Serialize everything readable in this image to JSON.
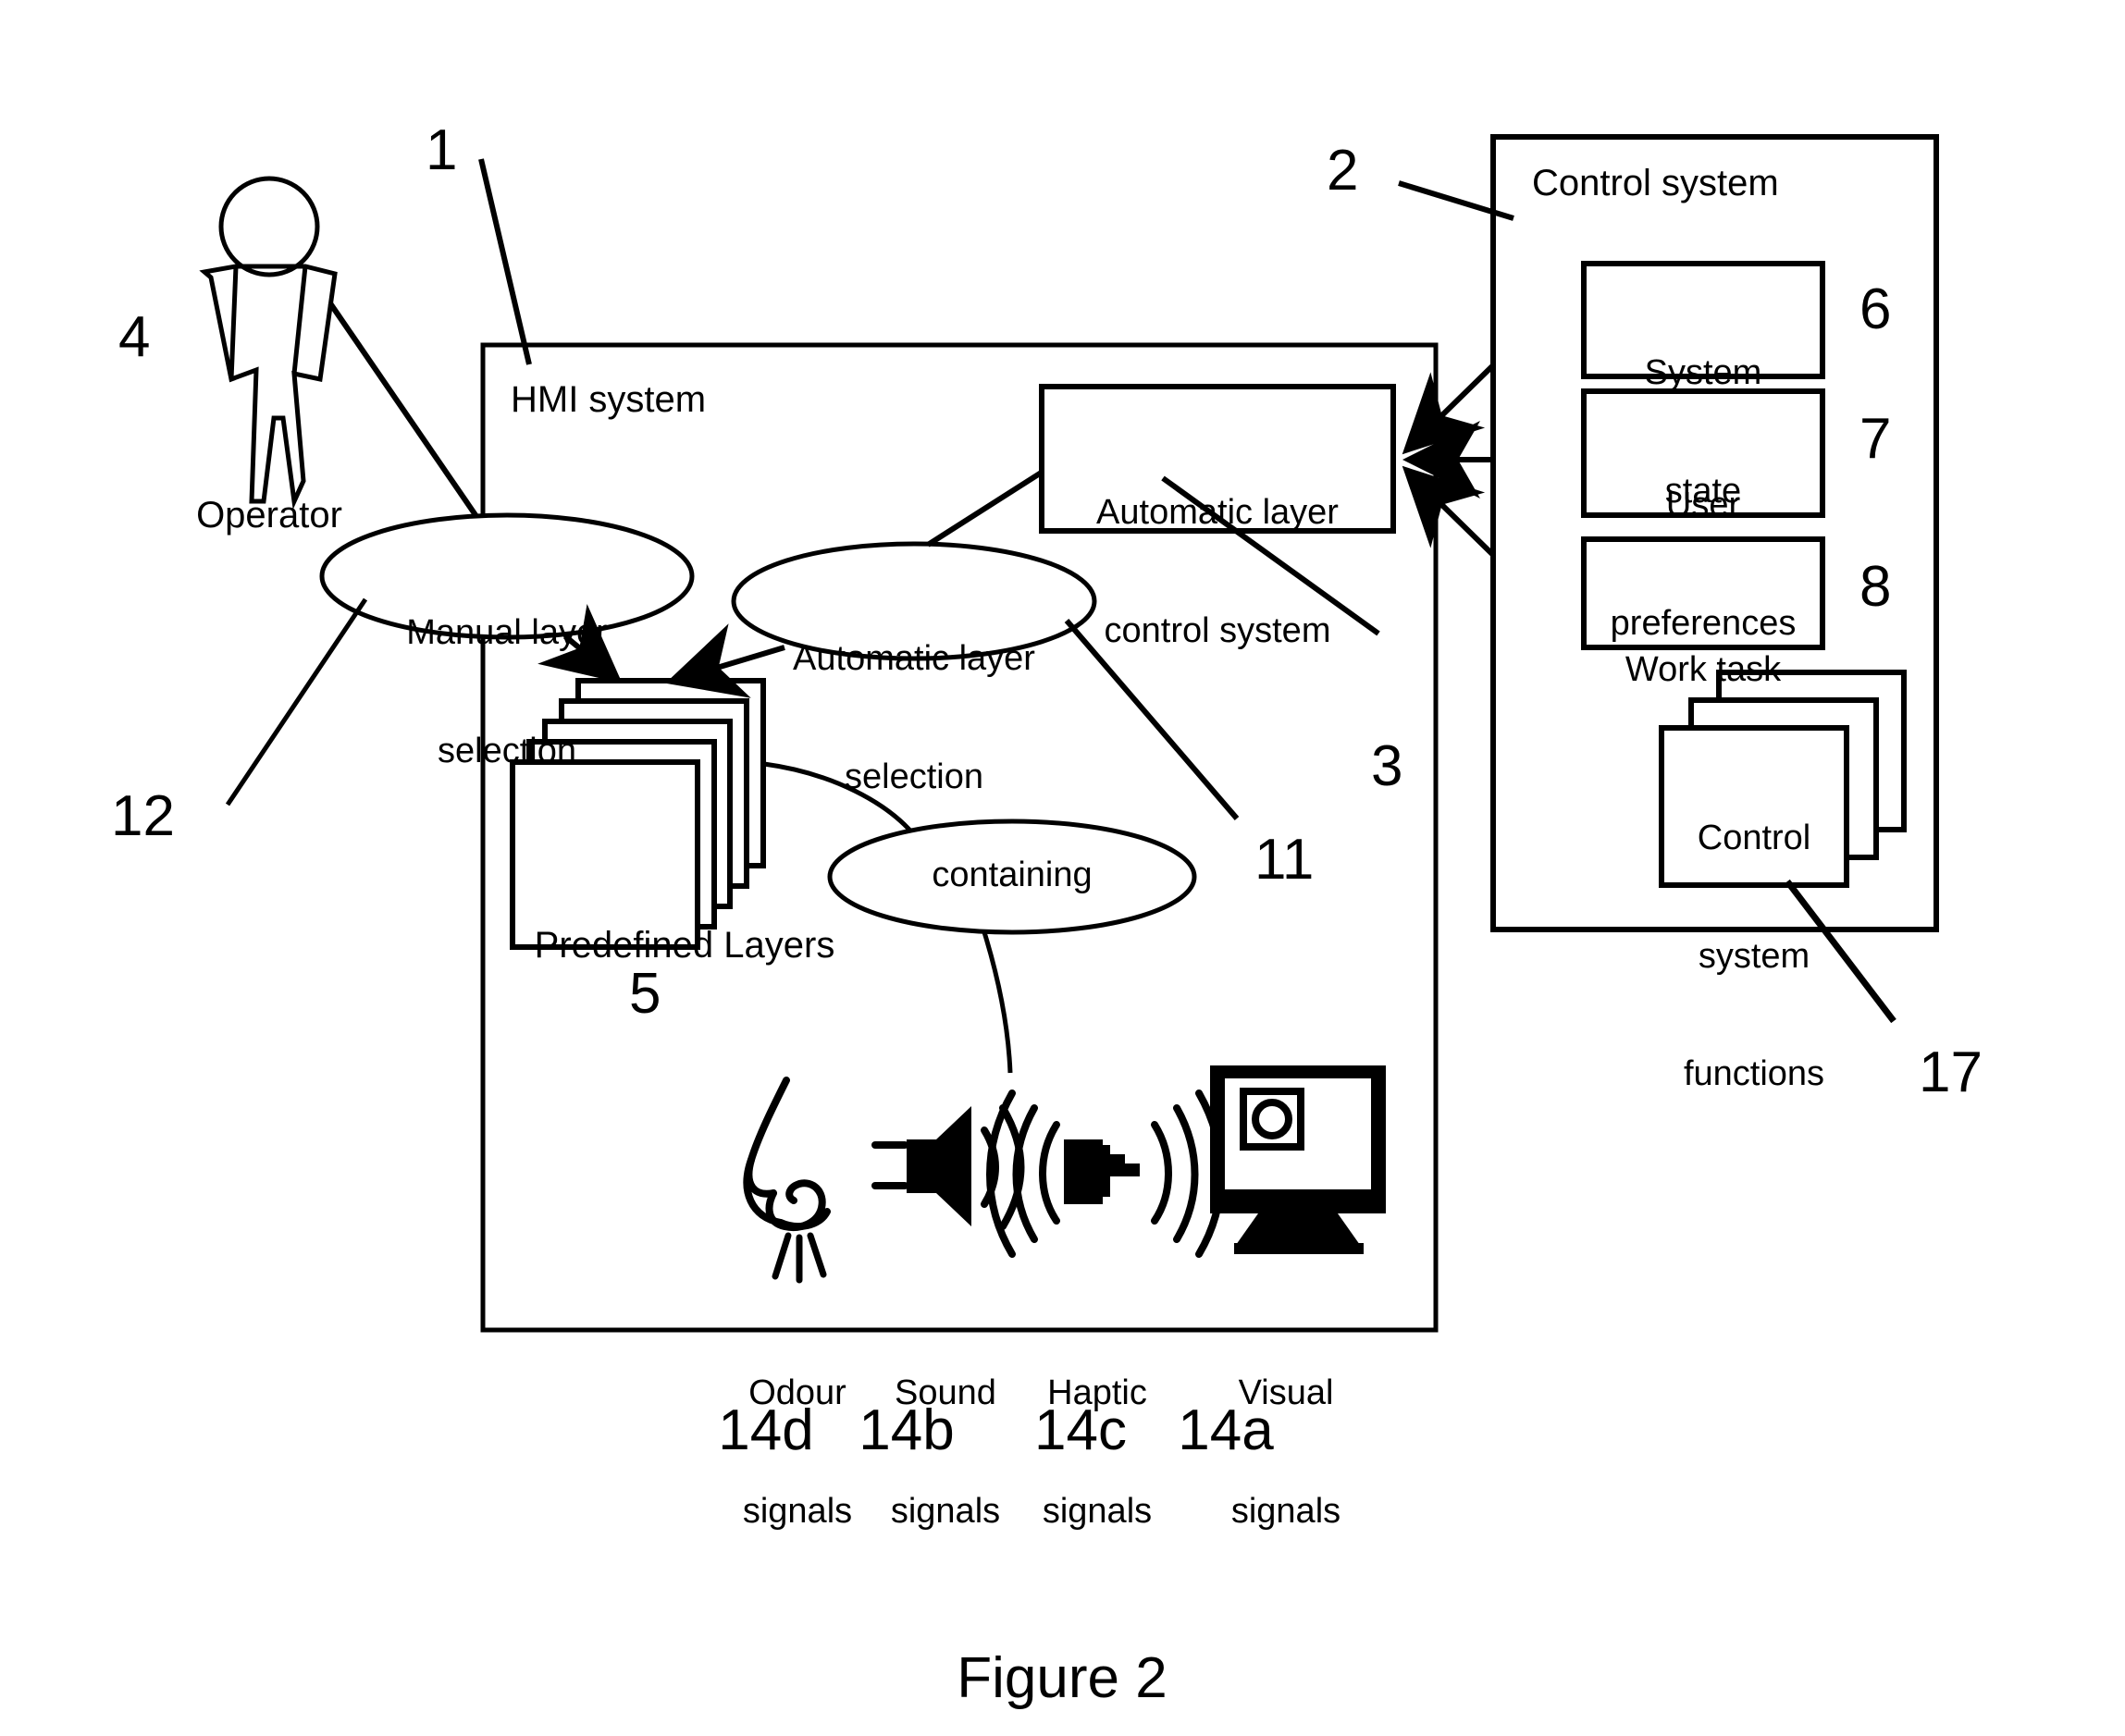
{
  "figure": {
    "caption": "Figure 2"
  },
  "containers": {
    "hmi": {
      "title": "HMI system",
      "ref": "1"
    },
    "control_system": {
      "title": "Control system",
      "ref": "2"
    }
  },
  "actor": {
    "label": "Operator",
    "ref": "4",
    "icon": "person-icon"
  },
  "nodes": {
    "manual_layer_selection": {
      "label_line1": "Manual layer",
      "label_line2": "selection",
      "ref": "12",
      "shape": "ellipse"
    },
    "automatic_layer_selection": {
      "label_line1": "Automatic layer",
      "label_line2": "selection",
      "ref": "11",
      "shape": "ellipse"
    },
    "automatic_layer_control_system": {
      "label_line1": "Automatic layer",
      "label_line2": "control system",
      "ref": "3",
      "shape": "rectangle"
    },
    "predefined_layers": {
      "label": "Predefined Layers",
      "ref": "5",
      "shape": "card-stack",
      "card_count": 5
    },
    "containing": {
      "label": "containing",
      "shape": "ellipse"
    },
    "control_system_functions": {
      "label_line1": "Control",
      "label_line2": "system",
      "label_line3": "functions",
      "ref": "17",
      "shape": "card-stack",
      "card_count": 3
    }
  },
  "control_system_items": [
    {
      "label_line1": "System",
      "label_line2": "state",
      "ref": "6"
    },
    {
      "label_line1": "User",
      "label_line2": "preferences",
      "ref": "7"
    },
    {
      "label_line1": "Work task",
      "label_line2": "",
      "ref": "8"
    }
  ],
  "signals": [
    {
      "icon": "nose-icon",
      "line1": "Odour",
      "line2": "signals",
      "ref": "14d"
    },
    {
      "icon": "speaker-icon",
      "line1": "Sound",
      "line2": "signals",
      "ref": "14b"
    },
    {
      "icon": "haptic-hand-icon",
      "line1": "Haptic",
      "line2": "signals",
      "ref": "14c"
    },
    {
      "icon": "monitor-icon",
      "line1": "Visual",
      "line2": "signals",
      "ref": "14a"
    }
  ],
  "colors": {
    "stroke": "#000000",
    "background": "#ffffff"
  }
}
